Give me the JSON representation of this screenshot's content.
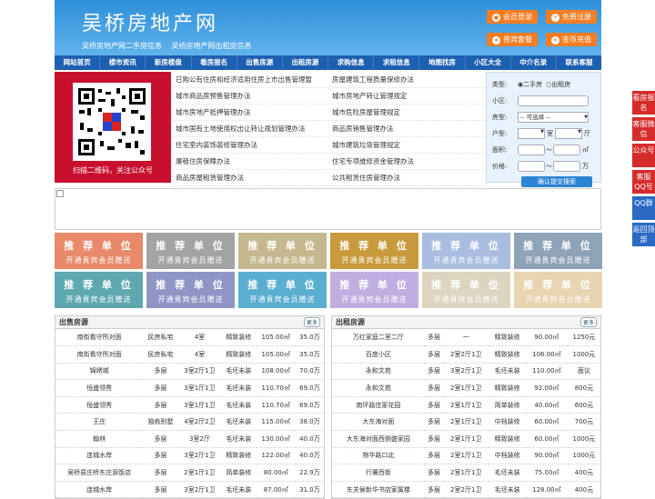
{
  "header": {
    "logo": "吴桥房地产网",
    "slogan": [
      "吴桥房地产网二手房信息",
      "吴桥房地产网出租房信息"
    ],
    "buttons": [
      {
        "label": "会员登录",
        "icon": "user-icon"
      },
      {
        "label": "免费注册",
        "icon": "register-icon"
      },
      {
        "label": "贵宾套餐",
        "icon": "vip-icon"
      },
      {
        "label": "金币充值",
        "icon": "coin-icon"
      }
    ]
  },
  "nav": [
    "网站首页",
    "楼市资讯",
    "新房楼盘",
    "看房报名",
    "出售房源",
    "出租房源",
    "求购信息",
    "求租信息",
    "地图找房",
    "小区大全",
    "中介名录",
    "联系客服"
  ],
  "qr": {
    "caption": "扫描二维码，关注公众号"
  },
  "links": [
    [
      "已购公有住房和经济适用住房上市出售管理暂",
      "房屋建筑工程质量保修办法"
    ],
    [
      "城市商品房预售管理办法",
      "城市房地产转让管理规定"
    ],
    [
      "城市房地产抵押管理办法",
      "城市危险房屋管理规定"
    ],
    [
      "城市国有土地使用权出让转让规划管理办法",
      "商品房销售管理办法"
    ],
    [
      "住宅室内装饰装修管理办法",
      "城市建筑垃圾管理规定"
    ],
    [
      "廉租住房保障办法",
      "住宅专项维修资金管理办法"
    ],
    [
      "商品房屋租赁管理办法",
      "公共租赁住房管理办法"
    ]
  ],
  "search": {
    "type_label": "类型:",
    "type_options": [
      "二手房",
      "出租房"
    ],
    "community_label": "小区:",
    "housetype_label": "房型:",
    "housetype_value": "-- 可选择 --",
    "layout_label": "户型:",
    "room_unit": "室",
    "hall_unit": "厅",
    "area_label": "面积:",
    "area_unit": "㎡",
    "price_label": "价格:",
    "price_unit": "万",
    "range_sep": "～",
    "submit": "确认提交搜索"
  },
  "tiles": {
    "title": "推 荐 单 位",
    "subtitle": "开通贵宾会员赠送",
    "colors": [
      "#e8896a",
      "#a3a3a3",
      "#c6b88e",
      "#c99a3d",
      "#a8bde0",
      "#8fa3b8",
      "#5fa8b0",
      "#8f96c6",
      "#5aaed0",
      "#c0aee0",
      "#ddd5c0",
      "#e8d4b0"
    ]
  },
  "sale": {
    "title": "出售房源",
    "more": "更多",
    "rows": [
      [
        "南街看守所对面",
        "民房私宅",
        "4室",
        "精致装修",
        "105.00㎡",
        "35.0万"
      ],
      [
        "南街看守所对面",
        "民房私宅",
        "4室",
        "精致装修",
        "105.00㎡",
        "35.0万"
      ],
      [
        "锦绣城",
        "多层",
        "3室2厅1卫",
        "毛坯未装",
        "108.00㎡",
        "70.0万"
      ],
      [
        "恒盛领秀",
        "多层",
        "3室1厅1卫",
        "毛坯未装",
        "110.70㎡",
        "69.0万"
      ],
      [
        "恒盛领秀",
        "多层",
        "3室1厅1卫",
        "毛坯未装",
        "110.70㎡",
        "69.0万"
      ],
      [
        "王庄",
        "独栋别墅",
        "4室2厅2卫",
        "毛坯未装",
        "115.00㎡",
        "38.0万"
      ],
      [
        "翰林",
        "多层",
        "3室2厅",
        "毛坯未装",
        "130.00㎡",
        "40.0万"
      ],
      [
        "连城水岸",
        "多层",
        "3室2厅1卫",
        "精致装修",
        "122.00㎡",
        "40.0万"
      ],
      [
        "吴桥县庄桥东庄源饭店",
        "多层",
        "2室1厅1卫",
        "简单装修",
        "80.00㎡",
        "22.9万"
      ],
      [
        "连城水岸",
        "多层",
        "3室2厅1卫",
        "毛坯未装",
        "87.00㎡",
        "31.0万"
      ]
    ]
  },
  "rent": {
    "title": "出租房源",
    "more": "更多",
    "rows": [
      [
        "万红家庭二室二厅",
        "多层",
        "一",
        "精致装修",
        "90.00㎡",
        "1250元"
      ],
      [
        "百度小区",
        "多层",
        "2室2厅1卫",
        "精致装修",
        "106.00㎡",
        "1000元"
      ],
      [
        "永和文苑",
        "多层",
        "3室2厅1卫",
        "毛坯未装",
        "110.00㎡",
        "面议"
      ],
      [
        "永和文苑",
        "多层",
        "2室1厅1卫",
        "精致装修",
        "92.00㎡",
        "800元"
      ],
      [
        "南环路佳家花园",
        "多层",
        "2室1厅1卫",
        "简单装修",
        "40.00㎡",
        "600元"
      ],
      [
        "大东海对面",
        "多层",
        "2室1厅1卫",
        "中档装修",
        "60.00㎡",
        "700元"
      ],
      [
        "大东海对面西侧盛家园",
        "多层",
        "2室1厅1卫",
        "精致装修",
        "60.00㎡",
        "1000元"
      ],
      [
        "物华路口北",
        "多层",
        "2室1厅1卫",
        "中档装修",
        "90.00㎡",
        "1000元"
      ],
      [
        "行署西街",
        "多层",
        "2室1厅1卫",
        "毛坯未装",
        "75.00㎡",
        "400元"
      ],
      [
        "东关侯新华书店家属楼",
        "多层",
        "2室2厅1卫",
        "毛坯未装",
        "128.00㎡",
        "400元"
      ]
    ]
  },
  "side": [
    "看房报名",
    "客服微信",
    "公众号",
    "客服QQ号",
    "QQ群",
    "返回顶部"
  ]
}
